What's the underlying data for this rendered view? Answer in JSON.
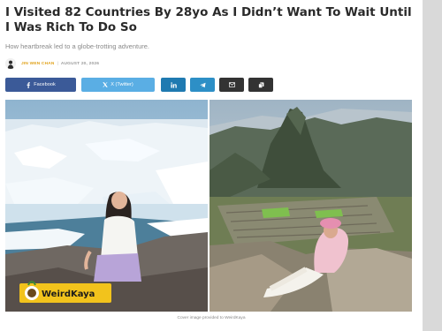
{
  "article": {
    "title": "I Visited 82 Countries By 28yo As I Didn’t Want To Wait Until I Was Rich To Do So",
    "subtitle": "How heartbreak led to a globe-trotting adventure.",
    "author": "JIN WEN CHAN",
    "separator": "|",
    "date": "AUGUST 20, 2026"
  },
  "share": {
    "facebook": "Facebook",
    "twitter": "X (Twitter)"
  },
  "hero": {
    "watermark": "WeirdKaya",
    "caption": "Cover image provided to WeirdKaya"
  },
  "colors": {
    "facebook": "#3b5a98",
    "twitter": "#5aaee4",
    "linkedin": "#1f7ab1",
    "telegram": "#2d8fc6",
    "email": "#333333",
    "copy": "#333333",
    "author_accent": "#e0a21b",
    "watermark_yellow": "#f2c31c"
  },
  "icons": [
    "facebook-icon",
    "x-twitter-icon",
    "linkedin-icon",
    "telegram-icon",
    "email-icon",
    "copy-icon"
  ]
}
